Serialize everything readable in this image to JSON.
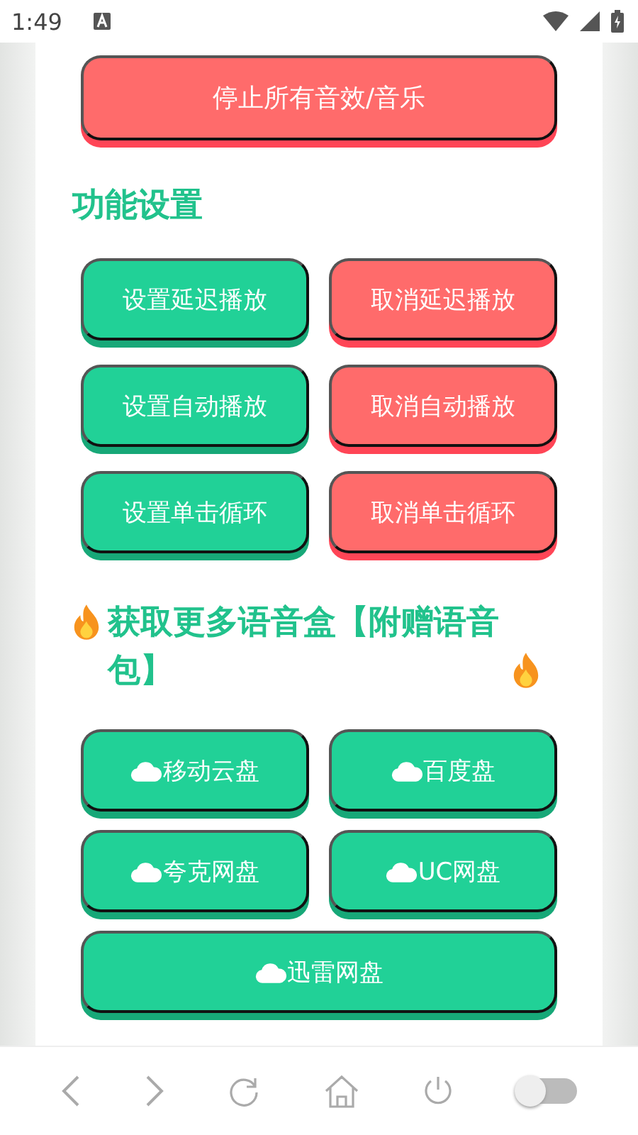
{
  "status_bar": {
    "time": "1:49"
  },
  "top_button": {
    "label": "停止所有音效/音乐",
    "kind": "cancel"
  },
  "settings": {
    "title": "功能设置",
    "buttons": [
      {
        "label": "设置延迟播放",
        "kind": "set"
      },
      {
        "label": "取消延迟播放",
        "kind": "cancel"
      },
      {
        "label": "设置自动播放",
        "kind": "set"
      },
      {
        "label": "取消自动播放",
        "kind": "cancel"
      },
      {
        "label": "设置单击循环",
        "kind": "set"
      },
      {
        "label": "取消单击循环",
        "kind": "cancel"
      }
    ]
  },
  "more": {
    "title": "获取更多语音盒【附赠语音包】",
    "links": [
      {
        "label": "移动云盘",
        "wide": false
      },
      {
        "label": "百度盘",
        "wide": false
      },
      {
        "label": "夸克网盘",
        "wide": false
      },
      {
        "label": "UC网盘",
        "wide": false
      },
      {
        "label": "迅雷网盘",
        "wide": true
      }
    ]
  },
  "browser_bar": {
    "toggle_on": false
  }
}
